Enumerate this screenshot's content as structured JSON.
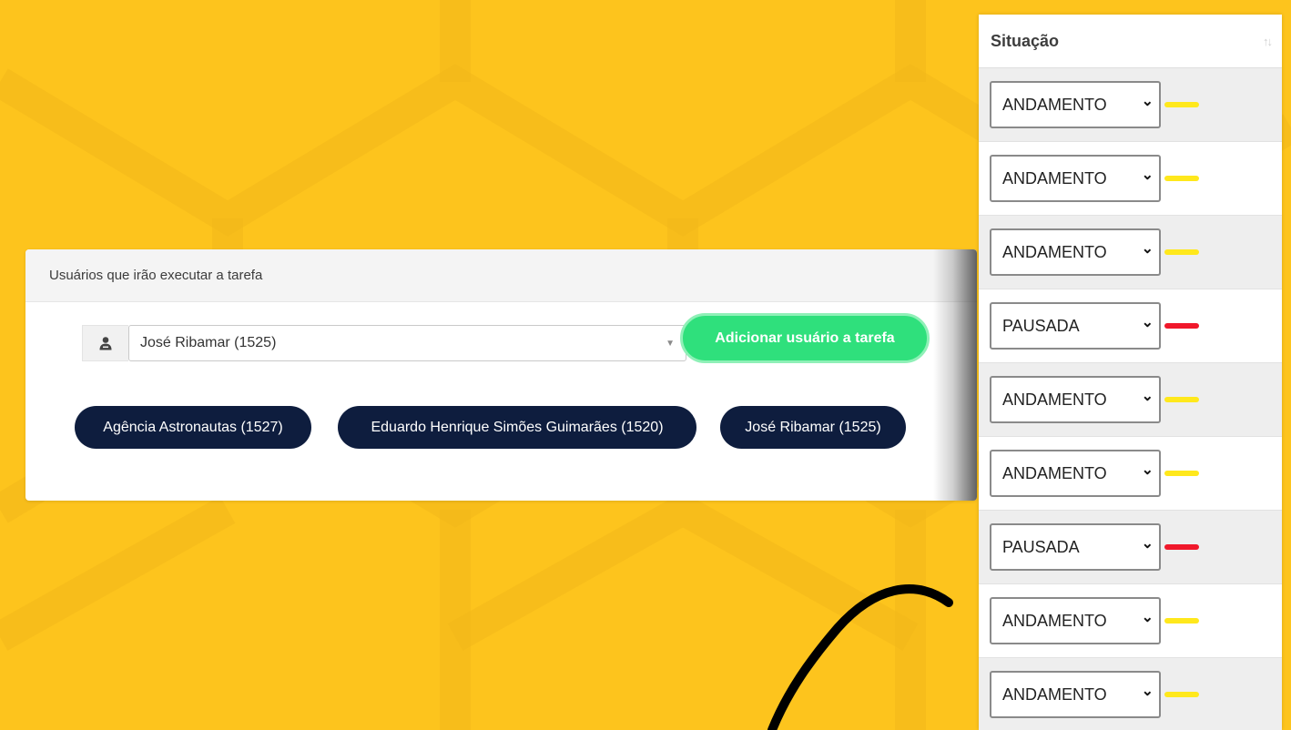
{
  "users_card": {
    "title": "Usuários que irão executar a tarefa",
    "selected_user": "José Ribamar (1525)",
    "add_button_label": "Adicionar usuário a tarefa",
    "user_icon": "user-icon",
    "assigned_users": [
      {
        "label": "Agência Astronautas (1527)"
      },
      {
        "label": "Eduardo Henrique Simões Guimarães (1520)"
      },
      {
        "label": "José Ribamar (1525)"
      }
    ]
  },
  "status_table": {
    "header": "Situação",
    "sort_icon": "sort-arrows-icon",
    "rows": [
      {
        "value": "ANDAMENTO",
        "status_color": "#FFE81C"
      },
      {
        "value": "ANDAMENTO",
        "status_color": "#FFE81C"
      },
      {
        "value": "ANDAMENTO",
        "status_color": "#FFE81C"
      },
      {
        "value": "PAUSADA",
        "status_color": "#F0182B"
      },
      {
        "value": "ANDAMENTO",
        "status_color": "#FFE81C"
      },
      {
        "value": "ANDAMENTO",
        "status_color": "#FFE81C"
      },
      {
        "value": "PAUSADA",
        "status_color": "#F0182B"
      },
      {
        "value": "ANDAMENTO",
        "status_color": "#FFE81C"
      },
      {
        "value": "ANDAMENTO",
        "status_color": "#FFE81C"
      }
    ]
  },
  "colors": {
    "background": "#FDC41D",
    "add_button": "#2FE07C",
    "chip": "#0E1D3E",
    "status_running": "#FFE81C",
    "status_paused": "#F0182B"
  }
}
